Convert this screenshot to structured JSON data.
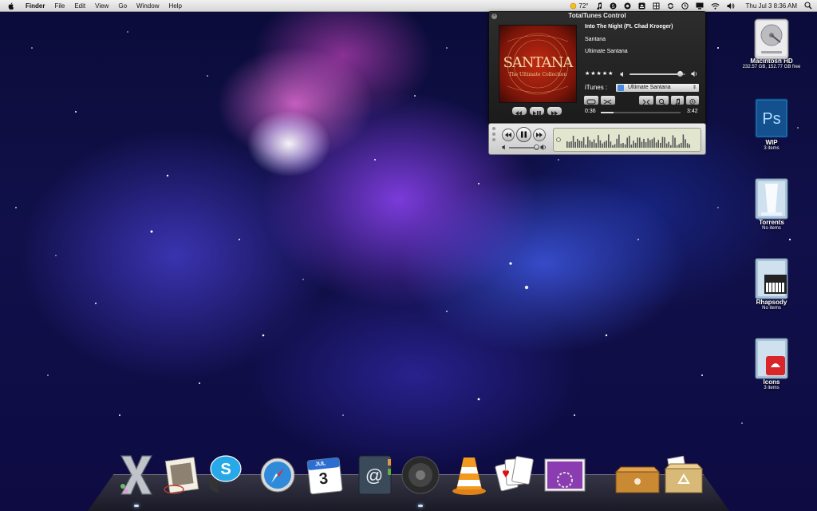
{
  "menubar": {
    "app_name": "Finder",
    "menus": [
      "File",
      "Edit",
      "View",
      "Go",
      "Window",
      "Help"
    ],
    "weather_temp": "72°",
    "clock": "Thu Jul 3  8:36 AM"
  },
  "totaltunes": {
    "title": "TotalTunes Control",
    "track_name": "Into The Night (Ft. Chad Kroeger)",
    "artist": "Santana",
    "album": "Ultimate Santana",
    "rating_stars": "★★★★★",
    "source_label": "iTunes :",
    "source_selected": "Ultimate Santana",
    "elapsed": "0:36",
    "duration": "3:42",
    "progress": 0.16,
    "volume": 0.9,
    "art_text": "SANTANA",
    "art_subtext": "The Ultimate Collection"
  },
  "desktop_icons": [
    {
      "name": "Macintosh HD",
      "info": "232.57 GB, 152.77 GB free",
      "icon": "harddrive-icon"
    },
    {
      "name": "WIP",
      "info": "3 items",
      "icon": "photoshop-folder-icon"
    },
    {
      "name": "Torrents",
      "info": "No items",
      "icon": "torrents-folder-icon"
    },
    {
      "name": "Rhapsody",
      "info": "No items",
      "icon": "piano-folder-icon"
    },
    {
      "name": "Icons",
      "info": "3 items",
      "icon": "icons-folder-icon"
    }
  ],
  "dock": [
    {
      "name": "Mac OS X",
      "icon": "osx-x-icon",
      "running": true
    },
    {
      "name": "Mail",
      "icon": "mail-stamp-icon",
      "running": false
    },
    {
      "name": "Skype",
      "icon": "skype-icon",
      "running": false
    },
    {
      "name": "Safari",
      "icon": "safari-compass-icon",
      "running": false
    },
    {
      "name": "iCal",
      "icon": "calendar-icon",
      "running": false,
      "month": "JUL",
      "day": "3"
    },
    {
      "name": "Address Book",
      "icon": "address-book-icon",
      "running": false
    },
    {
      "name": "Speaker",
      "icon": "speaker-icon",
      "running": true
    },
    {
      "name": "VLC",
      "icon": "vlc-cone-icon",
      "running": false
    },
    {
      "name": "Solitaire",
      "icon": "playing-cards-icon",
      "running": false
    },
    {
      "name": "Mirror",
      "icon": "photo-gear-icon",
      "running": false
    },
    {
      "name": "Box",
      "icon": "box-icon",
      "running": false
    },
    {
      "name": "Trash",
      "icon": "recycle-box-icon",
      "running": false
    }
  ]
}
